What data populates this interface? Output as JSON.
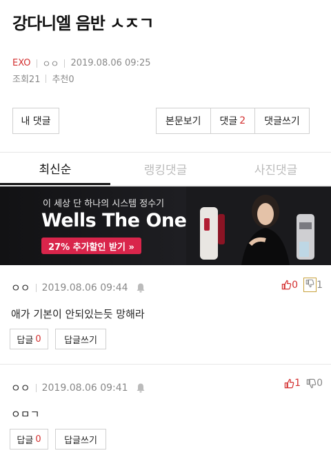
{
  "post": {
    "title": "강다니엘 음반 ㅅㅈㄱ",
    "category": "EXO",
    "author": "ㅇㅇ",
    "datetime": "2019.08.06 09:25",
    "views": "조회21",
    "recommend": "추천0"
  },
  "actions": {
    "my_comments": "내 댓글",
    "view_body": "본문보기",
    "comments_label": "댓글",
    "comments_count": "2",
    "write_comment": "댓글쓰기"
  },
  "tabs": [
    {
      "label": "최신순",
      "active": true
    },
    {
      "label": "랭킹댓글",
      "active": false
    },
    {
      "label": "사진댓글",
      "active": false
    }
  ],
  "ad": {
    "tagline": "이 세상 단 하나의 시스템 정수기",
    "brand": "Wells The One",
    "cta": "27% 추가할인 받기 »"
  },
  "comments": [
    {
      "author": "ㅇㅇ",
      "datetime": "2019.08.06 09:44",
      "text": "애가 기본이 안되있는듯 망해라",
      "up": "0",
      "down": "1",
      "reply_label": "답글",
      "reply_count": "0",
      "write_reply": "답글쓰기"
    },
    {
      "author": "ㅇㅇ",
      "datetime": "2019.08.06 09:41",
      "text": "ㅇㅁㄱ",
      "up": "1",
      "down": "0",
      "reply_label": "답글",
      "reply_count": "0",
      "write_reply": "답글쓰기"
    }
  ],
  "colors": {
    "accent_red": "#d32f2f",
    "ad_cta": "#d9254b"
  }
}
